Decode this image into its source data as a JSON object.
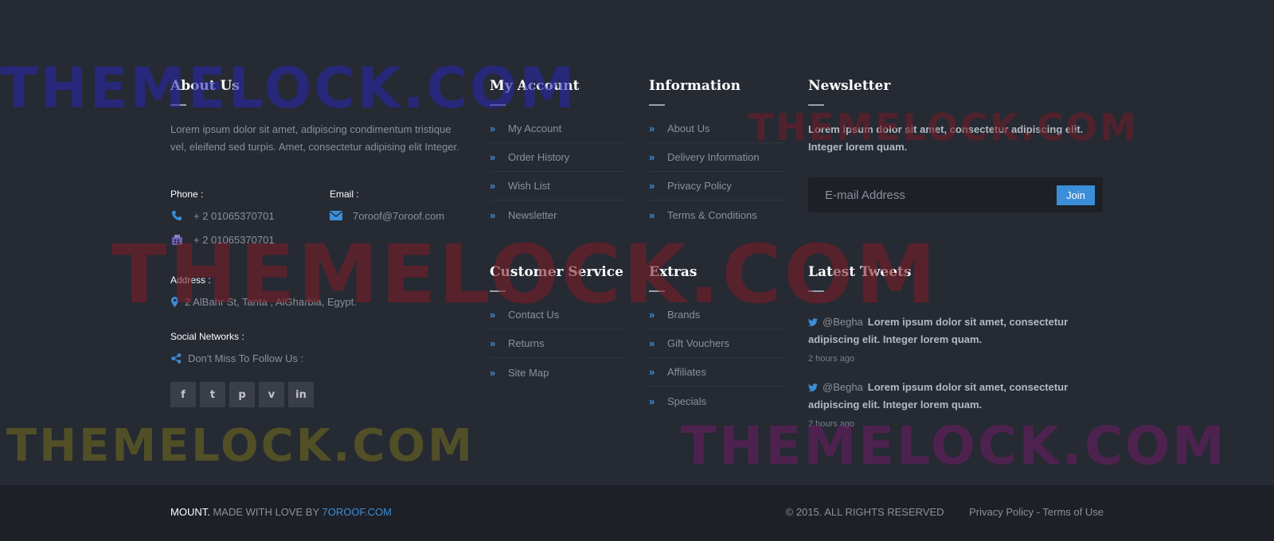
{
  "about": {
    "title": "About Us",
    "text": "Lorem ipsum dolor sit amet, adipiscing condimentum tristique vel, eleifend sed turpis. Amet, consectetur adipising elit Integer.",
    "phone_label": "Phone :",
    "phone_1": "+ 2 01065370701",
    "phone_2": "+ 2 01065370701",
    "email_label": "Email :",
    "email": "7oroof@7oroof.com",
    "address_label": "Address :",
    "address": "2 AlBahr St, Tanta , AlGharbia, Egypt.",
    "social_label": "Social Networks :",
    "social_text": "Don't Miss To Follow Us :",
    "social_icons": [
      {
        "name": "facebook-icon",
        "glyph": "f"
      },
      {
        "name": "twitter-icon",
        "glyph": "t"
      },
      {
        "name": "pinterest-icon",
        "glyph": "p"
      },
      {
        "name": "vimeo-icon",
        "glyph": "v"
      },
      {
        "name": "linkedin-icon",
        "glyph": "in"
      }
    ]
  },
  "my_account": {
    "title": "My Account",
    "items": [
      "My Account",
      "Order History",
      "Wish List",
      "Newsletter"
    ]
  },
  "information": {
    "title": "Information",
    "items": [
      "About Us",
      "Delivery Information",
      "Privacy Policy",
      "Terms & Conditions"
    ]
  },
  "newsletter": {
    "title": "Newsletter",
    "text": "Lorem ipsum dolor sit amet, consectetur adipiscing elit. Integer lorem quam.",
    "input_placeholder": "E-mail Address",
    "join_label": "Join"
  },
  "customer_service": {
    "title": "Customer Service",
    "items": [
      "Contact Us",
      "Returns",
      "Site Map"
    ]
  },
  "extras": {
    "title": "Extras",
    "items": [
      "Brands",
      "Gift Vouchers",
      "Affiliates",
      "Specials"
    ]
  },
  "tweets": {
    "title": "Latest Tweets",
    "items": [
      {
        "handle": "@Begha",
        "text": "Lorem ipsum dolor sit amet, consectetur adipiscing elit. Integer lorem quam.",
        "time": "2 hours ago"
      },
      {
        "handle": "@Begha",
        "text": "Lorem ipsum dolor sit amet, consectetur adipiscing elit. Integer lorem quam.",
        "time": "2 hours ago"
      }
    ]
  },
  "bottom": {
    "brand": "MOUNT.",
    "made_with": "MADE WITH LOVE BY",
    "author_link": "7OROOF.COM",
    "copyright": "© 2015. ALL RIGHTS RESERVED",
    "privacy": "Privacy Policy",
    "separator": "-",
    "terms": "Terms of Use"
  },
  "watermark": "THEMELOCK.COM",
  "colors": {
    "background": "#262a33",
    "bottom_bar": "#1d2027",
    "accent": "#3b8ed8",
    "heading": "#ffffff",
    "text": "#8b909a"
  }
}
